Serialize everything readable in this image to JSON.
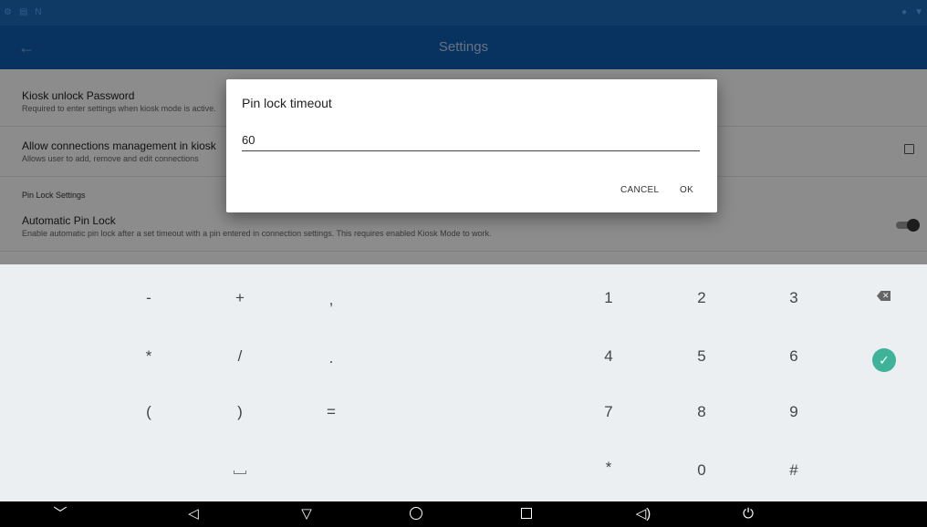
{
  "app_bar": {
    "title": "Settings"
  },
  "preferences": [
    {
      "title": "Kiosk unlock Password",
      "summary": "Required to enter settings when kiosk mode is active."
    },
    {
      "title": "Allow connections management in kiosk",
      "summary": "Allows user to add, remove and edit connections"
    }
  ],
  "section_header": "Pin Lock Settings",
  "auto_pin_lock": {
    "title": "Automatic Pin Lock",
    "summary": "Enable automatic pin lock after a set timeout with a pin entered in connection settings. This requires enabled Kiosk Mode to work."
  },
  "dialog": {
    "title": "Pin lock timeout",
    "value": "60",
    "cancel_label": "CANCEL",
    "ok_label": "OK"
  },
  "keyboard": {
    "symbols": [
      [
        "-",
        "+",
        ","
      ],
      [
        "*",
        "/",
        "."
      ],
      [
        "(",
        ")",
        "="
      ]
    ],
    "digits": [
      [
        "1",
        "2",
        "3"
      ],
      [
        "4",
        "5",
        "6"
      ],
      [
        "7",
        "8",
        "9"
      ],
      [
        "*",
        "0",
        "#"
      ]
    ]
  },
  "colors": {
    "status_bar": "#0f3a66",
    "app_bar": "#0f5db0",
    "keyboard_bg": "#eceff1",
    "accent": "#3fb39a"
  },
  "icons": [
    "back-arrow-icon",
    "backspace-icon",
    "enter-check-icon",
    "space-icon",
    "hide-keyboard-icon",
    "volume-down-icon",
    "back-icon",
    "home-icon",
    "recents-icon",
    "volume-up-icon",
    "power-icon"
  ]
}
